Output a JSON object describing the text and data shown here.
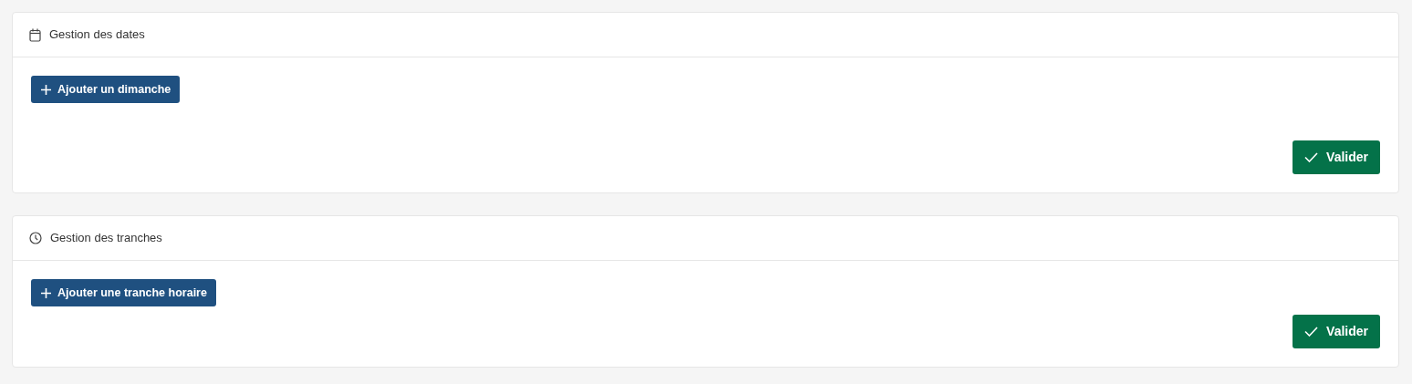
{
  "panels": [
    {
      "title": "Gestion des dates",
      "add_button": {
        "label": "Ajouter un dimanche"
      },
      "submit_button": {
        "label": "Valider"
      }
    },
    {
      "title": "Gestion des tranches",
      "add_button": {
        "label": "Ajouter une tranche horaire"
      },
      "submit_button": {
        "label": "Valider"
      }
    }
  ]
}
